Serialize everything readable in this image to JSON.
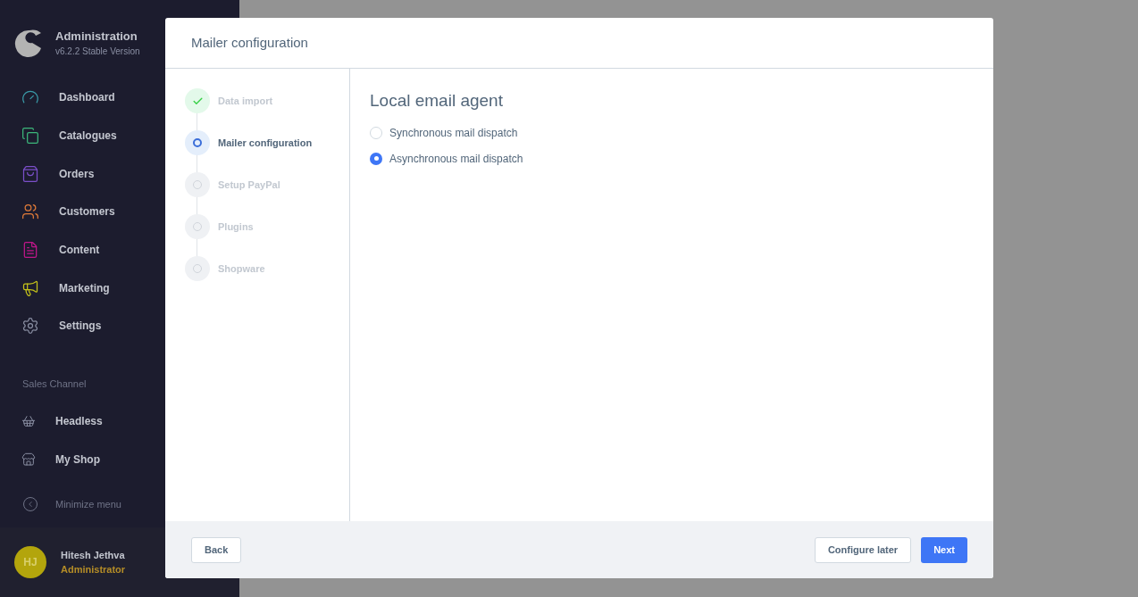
{
  "sidebar": {
    "title": "Administration",
    "version": "v6.2.2 Stable Version",
    "items": [
      {
        "label": "Dashboard",
        "color": "#3a9aa8"
      },
      {
        "label": "Catalogues",
        "color": "#3cb77b"
      },
      {
        "label": "Orders",
        "color": "#7b4fc9"
      },
      {
        "label": "Customers",
        "color": "#e07b39"
      },
      {
        "label": "Content",
        "color": "#c0168a"
      },
      {
        "label": "Marketing",
        "color": "#c4c21a"
      },
      {
        "label": "Settings",
        "color": "#8a8fa3"
      }
    ],
    "section_title": "Sales Channel",
    "channels": [
      {
        "label": "Headless"
      },
      {
        "label": "My Shop"
      }
    ],
    "minimize": "Minimize menu",
    "user": {
      "initials": "HJ",
      "name": "Hitesh Jethva",
      "role": "Administrator"
    }
  },
  "modal": {
    "title": "Mailer configuration",
    "steps": [
      {
        "label": "Data import",
        "kind": "done"
      },
      {
        "label": "Mailer configuration",
        "kind": "active"
      },
      {
        "label": "Setup PayPal",
        "kind": "pending"
      },
      {
        "label": "Plugins",
        "kind": "pending"
      },
      {
        "label": "Shopware",
        "kind": "pending"
      }
    ],
    "heading": "Local email agent",
    "options": [
      {
        "label": "Synchronous mail dispatch",
        "selected": false
      },
      {
        "label": "Asynchronous mail dispatch",
        "selected": true
      }
    ],
    "back": "Back",
    "configure_later": "Configure later",
    "next": "Next"
  }
}
